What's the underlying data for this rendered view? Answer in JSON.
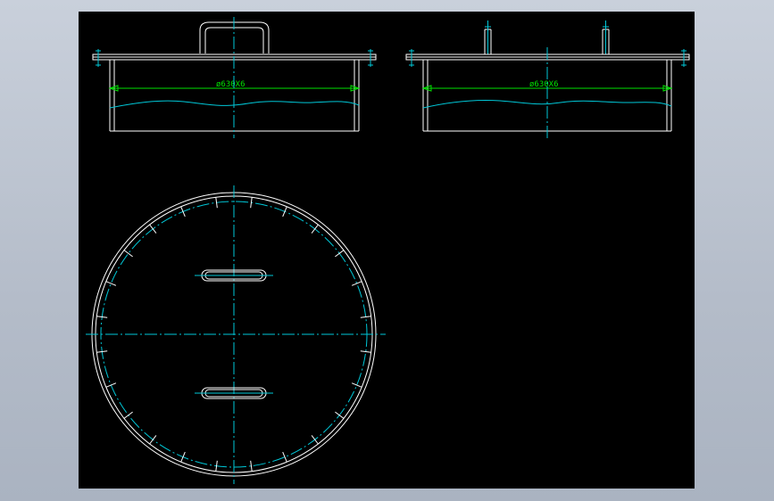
{
  "drawing": {
    "colors": {
      "background": "#000000",
      "outline": "#ffffff",
      "centerline": "#00c8d8",
      "dimension": "#00e000",
      "frame": "#b4bcc9"
    },
    "front_view": {
      "dimension_label": "ø630X6"
    },
    "side_view": {
      "dimension_label": "ø630X6"
    },
    "plan_view": {}
  }
}
